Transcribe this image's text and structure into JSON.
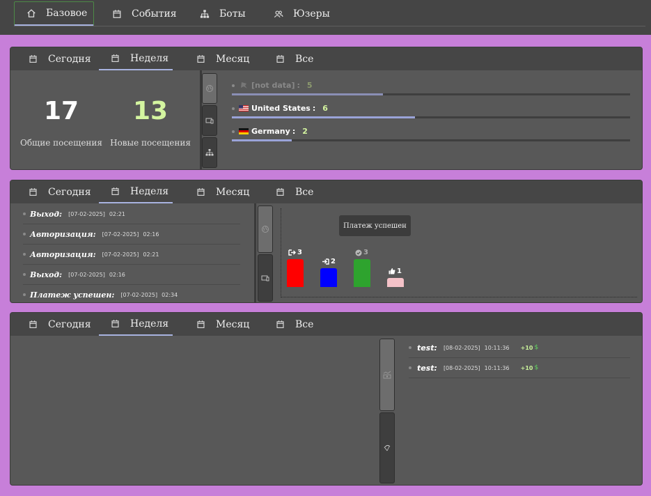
{
  "nav": [
    {
      "label": "Базовое",
      "icon": "home-icon"
    },
    {
      "label": "События",
      "icon": "calendar-icon"
    },
    {
      "label": "Боты",
      "icon": "sitemap-icon"
    },
    {
      "label": "Юзеры",
      "icon": "users-icon"
    }
  ],
  "period_tabs": [
    "Сегодня",
    "Неделя",
    "Месяц",
    "Все"
  ],
  "active_period": "Неделя",
  "visits": {
    "total": {
      "value": "17",
      "label": "Общие посещения"
    },
    "new": {
      "value": "13",
      "label": "Новые посещения"
    }
  },
  "countries": [
    {
      "flag": "none",
      "name": "[not data]",
      "value": "5",
      "fraction": 0.38
    },
    {
      "flag": "us",
      "name": "United States",
      "value": "6",
      "fraction": 0.46
    },
    {
      "flag": "de",
      "name": "Germany",
      "value": "2",
      "fraction": 0.15
    }
  ],
  "events": [
    {
      "name": "Выход:",
      "date": "[07-02-2025]",
      "time": "02:21"
    },
    {
      "name": "Авторизация:",
      "date": "[07-02-2025]",
      "time": "02:16"
    },
    {
      "name": "Авторизация:",
      "date": "[07-02-2025]",
      "time": "02:21"
    },
    {
      "name": "Выход:",
      "date": "[07-02-2025]",
      "time": "02:16"
    },
    {
      "name": "Платеж успешен:",
      "date": "[07-02-2025]",
      "time": "02:34"
    }
  ],
  "chart_tooltip": "Платеж успешен",
  "chart_data": {
    "type": "bar",
    "categories": [
      "exit",
      "login",
      "payment",
      "like"
    ],
    "values": [
      3,
      2,
      3,
      1
    ],
    "colors": [
      "#ff0000",
      "#0000ff",
      "#2ea32e",
      "#f4c2c8"
    ],
    "icons": [
      "sign-out-icon",
      "sign-in-icon",
      "check-circle-icon",
      "thumbs-up-icon"
    ],
    "ylim": [
      0,
      3
    ]
  },
  "transactions": [
    {
      "name": "test:",
      "date": "[08-02-2025]",
      "time": "10:11:36",
      "amount": "+10",
      "currency": "$"
    },
    {
      "name": "test:",
      "date": "[08-02-2025]",
      "time": "10:11:36",
      "amount": "+10",
      "currency": "$"
    }
  ],
  "colors": {
    "accent_underline": "#a8b3e0",
    "new_visits": "#d4f5a0",
    "amount": "#c9f29a"
  }
}
